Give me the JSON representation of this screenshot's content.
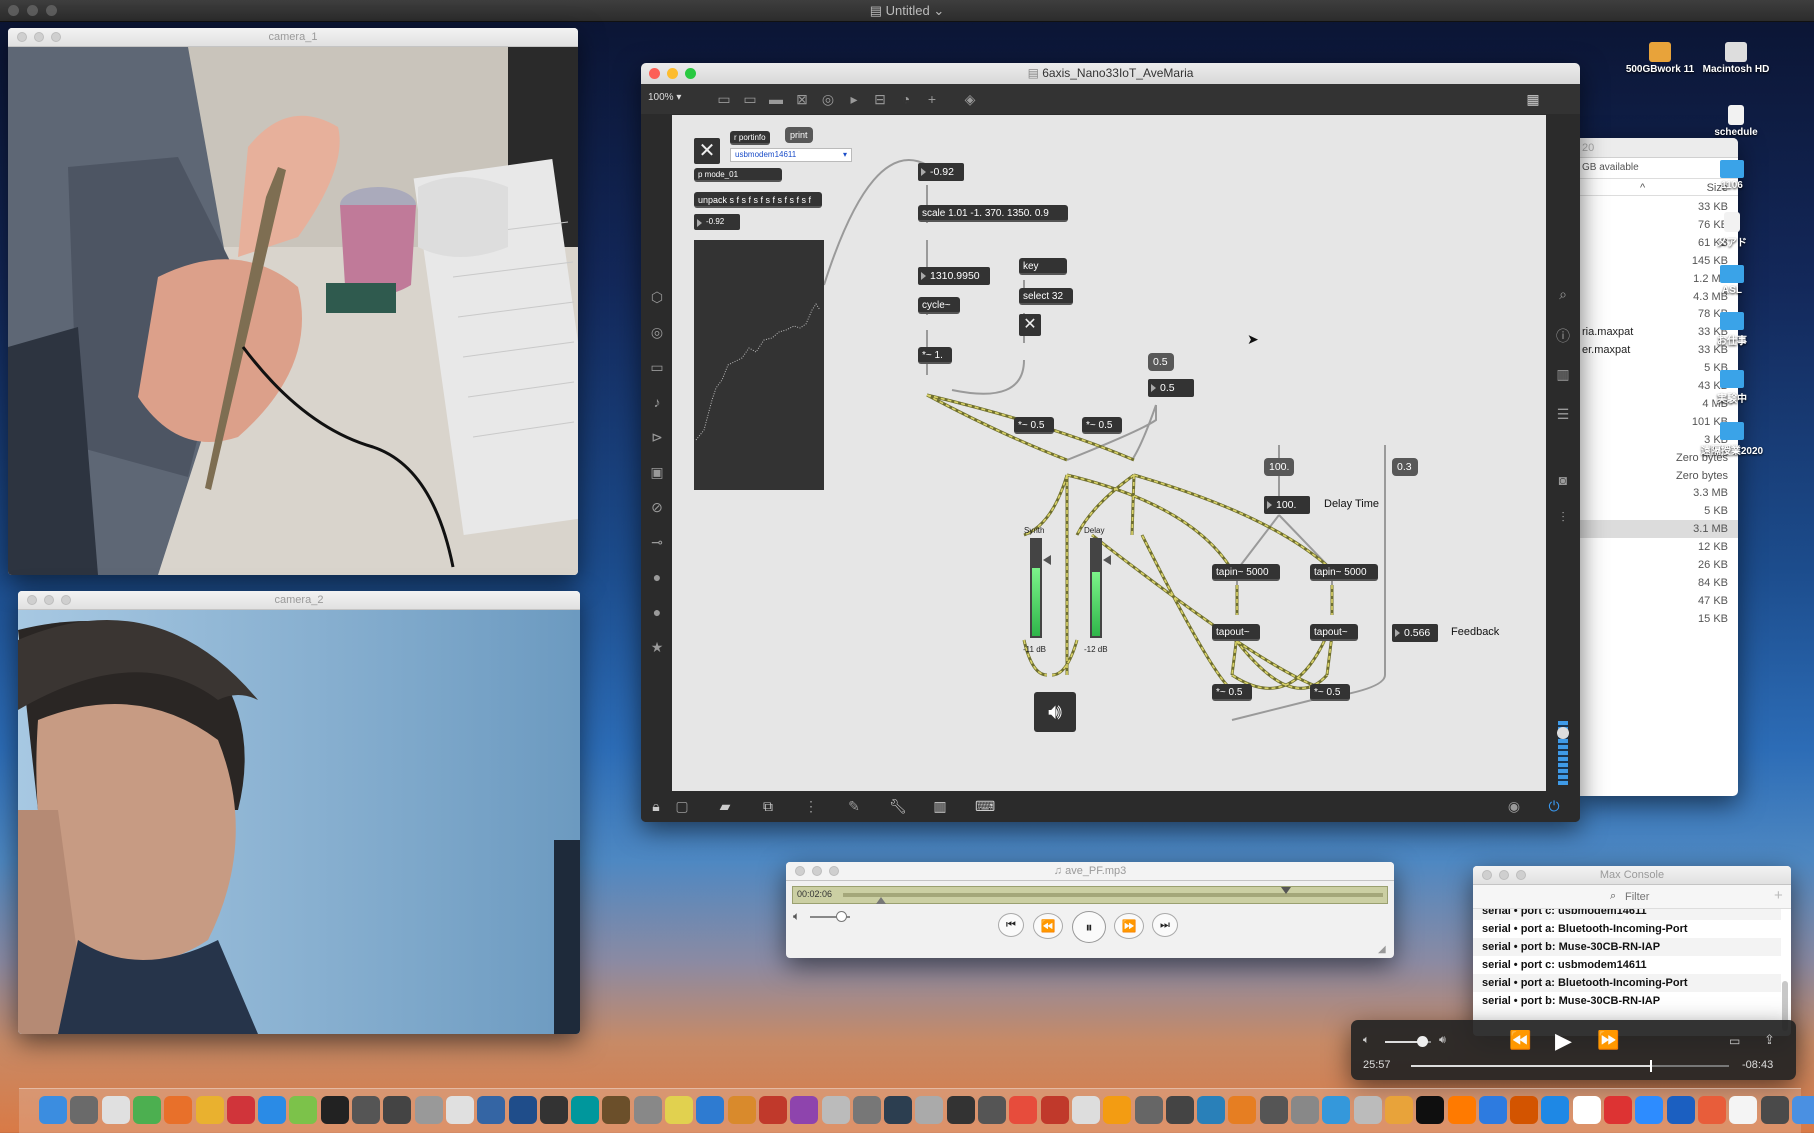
{
  "menubar": {
    "title": "Untitled"
  },
  "camera1": {
    "title": "camera_1"
  },
  "camera2": {
    "title": "camera_2"
  },
  "max_window": {
    "title": "6axis_Nano33IoT_AveMaria",
    "zoom": "100%",
    "objects": {
      "portinfo": "r portinfo",
      "print": "print",
      "port_menu": "usbmodem14611",
      "mode": "p mode_01",
      "unpack": "unpack s f s f s f s f s f s f s f",
      "num_a": "-0.92",
      "num_b": "-0.92",
      "scale": "scale 1.01 -1. 370. 1350. 0.9",
      "num_freq": "1310.9950",
      "key": "key",
      "select": "select 32",
      "cycle": "cycle~",
      "mul1": "*~ 1.",
      "msg_05": "0.5",
      "num_05": "0.5",
      "mul_a": "*~ 0.5",
      "mul_b": "*~ 0.5",
      "msg_100": "100.",
      "msg_03": "0.3",
      "num_100": "100.",
      "delay_time": "Delay Time",
      "synth_label": "Synth",
      "delay_label": "Delay",
      "synth_db": "-11 dB",
      "delay_db": "-12 dB",
      "tapin1": "tapin~ 5000",
      "tapin2": "tapin~ 5000",
      "tapout1": "tapout~",
      "tapout2": "tapout~",
      "num_fb": "0.566",
      "feedback": "Feedback",
      "mul_c": "*~ 0.5",
      "mul_d": "*~ 0.5"
    }
  },
  "finder": {
    "header_available": "GB available",
    "size_header": "Size",
    "rows": [
      {
        "name": "",
        "size": "33 KB"
      },
      {
        "name": "",
        "size": "76 KB"
      },
      {
        "name": "",
        "size": "61 KB"
      },
      {
        "name": "",
        "size": "145 KB"
      },
      {
        "name": "",
        "size": "1.2 MB"
      },
      {
        "name": "",
        "size": "4.3 MB"
      },
      {
        "name": "",
        "size": "78 KB"
      },
      {
        "name": "ria.maxpat",
        "size": "33 KB"
      },
      {
        "name": "er.maxpat",
        "size": "33 KB"
      },
      {
        "name": "",
        "size": "5 KB"
      },
      {
        "name": "",
        "size": "43 KB"
      },
      {
        "name": "",
        "size": "4 MB"
      },
      {
        "name": "",
        "size": "101 KB"
      },
      {
        "name": "",
        "size": "3 KB"
      },
      {
        "name": "",
        "size": "Zero bytes"
      },
      {
        "name": "",
        "size": "Zero bytes"
      },
      {
        "name": "",
        "size": "3.3 MB"
      },
      {
        "name": "",
        "size": "5 KB"
      },
      {
        "name": "",
        "size": "3.1 MB"
      },
      {
        "name": "",
        "size": "12 KB"
      },
      {
        "name": "",
        "size": "26 KB"
      },
      {
        "name": "",
        "size": "84 KB"
      },
      {
        "name": "",
        "size": "47 KB"
      },
      {
        "name": "",
        "size": "15 KB"
      }
    ]
  },
  "desktop": {
    "icons": [
      {
        "label": "500GBwork 11",
        "kind": "drive"
      },
      {
        "label": "Macintosh HD",
        "kind": "drive"
      },
      {
        "label": "schedule",
        "kind": "doc"
      },
      {
        "label": "1106",
        "kind": "folder"
      },
      {
        "label": "メアド",
        "kind": "doc"
      },
      {
        "label": "ASL",
        "kind": "folder"
      },
      {
        "label": "お仕事",
        "kind": "folder"
      },
      {
        "label": "実験中",
        "kind": "folder"
      },
      {
        "label": "遠隔授業2020",
        "kind": "folder"
      }
    ]
  },
  "player": {
    "title": "ave_PF.mp3",
    "time": "00:02:06",
    "progress": 0.07
  },
  "console": {
    "title": "Max Console",
    "filter_placeholder": "Filter",
    "lines": [
      "serial • port c: usbmodem14611",
      "serial • port a: Bluetooth-Incoming-Port",
      "serial • port b: Muse-30CB-RN-IAP",
      "serial • port c: usbmodem14611",
      "serial • port a: Bluetooth-Incoming-Port",
      "serial • port b: Muse-30CB-RN-IAP"
    ]
  },
  "quicktime": {
    "elapsed": "25:57",
    "remaining": "-08:43",
    "progress": 0.75,
    "volume": 0.8
  },
  "colors": {
    "accent": "#2f7bd8",
    "patch_bg": "#e6e6e6",
    "object_bg": "#333333",
    "cord": "#c8c85a"
  }
}
